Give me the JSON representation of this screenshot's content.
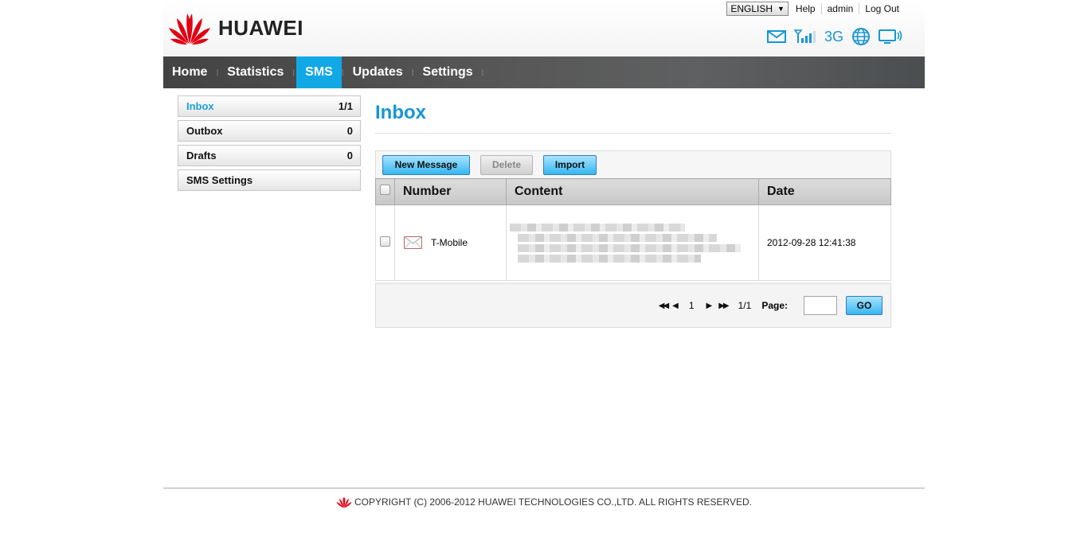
{
  "brand": {
    "name": "HUAWEI"
  },
  "toplinks": {
    "language": "ENGLISH",
    "help": "Help",
    "user": "admin",
    "logout": "Log Out"
  },
  "status": {
    "network": "3G",
    "icons": [
      "envelope-icon",
      "signal-icon",
      "globe-icon",
      "monitor-icon"
    ]
  },
  "nav": {
    "items": [
      "Home",
      "Statistics",
      "SMS",
      "Updates",
      "Settings"
    ],
    "active": "SMS"
  },
  "sidebar": {
    "items": [
      {
        "label": "Inbox",
        "count": "1/1"
      },
      {
        "label": "Outbox",
        "count": "0"
      },
      {
        "label": "Drafts",
        "count": "0"
      },
      {
        "label": "SMS Settings",
        "count": ""
      }
    ]
  },
  "main": {
    "title": "Inbox",
    "toolbar": {
      "new": "New Message",
      "delete": "Delete",
      "import": "Import"
    },
    "table": {
      "headers": [
        "Number",
        "Content",
        "Date"
      ],
      "rows": [
        {
          "number": "T-Mobile",
          "date": "2012-09-28 12:41:38"
        }
      ]
    },
    "pager": {
      "current": "1",
      "total": "1/1",
      "page_label": "Page:",
      "go": "GO"
    }
  },
  "footer": {
    "text": "COPYRIGHT (C) 2006-2012 HUAWEI TECHNOLOGIES CO.,LTD. ALL RIGHTS RESERVED."
  },
  "colors": {
    "accent": "#11a8e6",
    "title": "#1796d4",
    "brand_red": "#e10012"
  }
}
